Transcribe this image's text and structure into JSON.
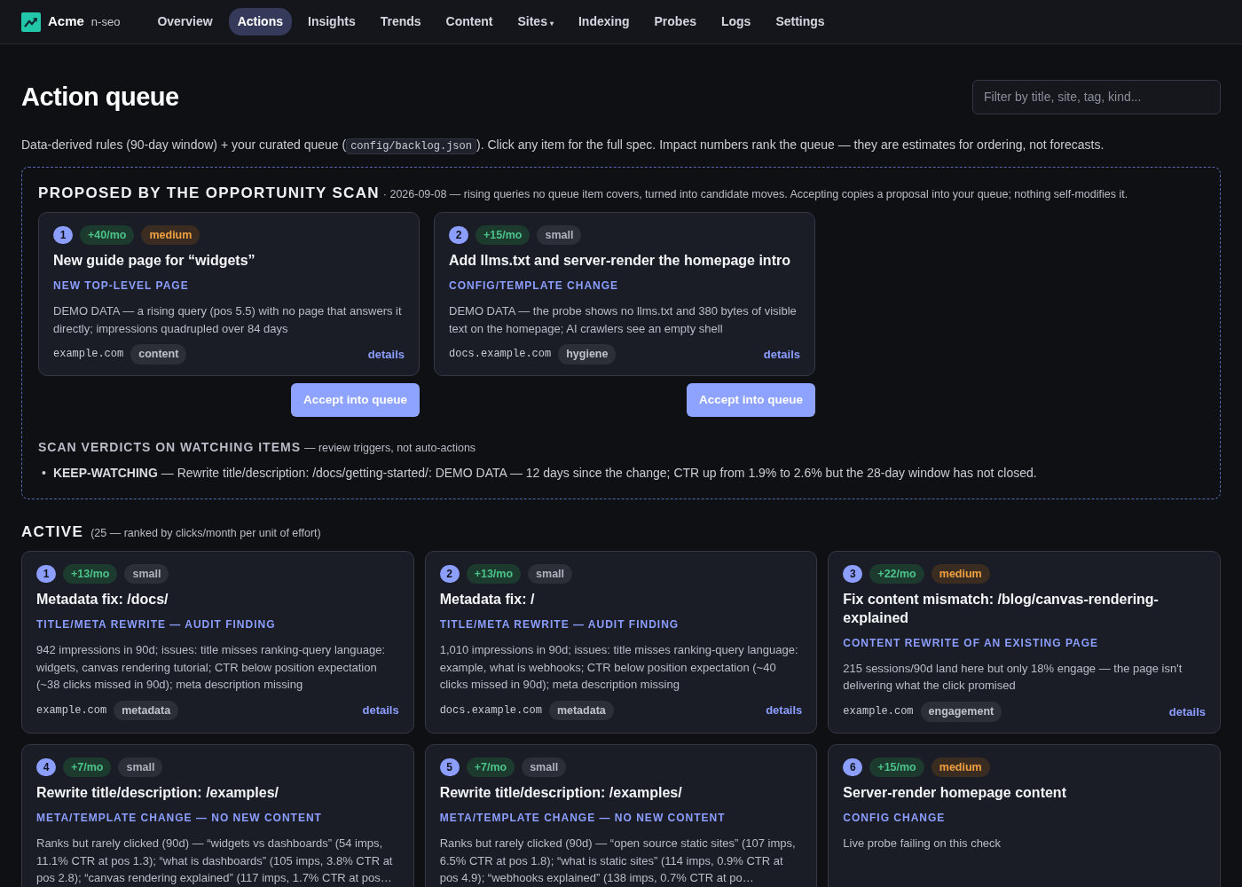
{
  "brand": {
    "name": "Acme",
    "suffix": "n-seo"
  },
  "nav": [
    {
      "label": "Overview",
      "selected": false
    },
    {
      "label": "Actions",
      "selected": true
    },
    {
      "label": "Insights",
      "selected": false
    },
    {
      "label": "Trends",
      "selected": false
    },
    {
      "label": "Content",
      "selected": false
    },
    {
      "label": "Sites",
      "selected": false,
      "caret": "▾"
    },
    {
      "label": "Indexing",
      "selected": false
    },
    {
      "label": "Probes",
      "selected": false
    },
    {
      "label": "Logs",
      "selected": false
    },
    {
      "label": "Settings",
      "selected": false
    }
  ],
  "page": {
    "title": "Action queue",
    "filter": {
      "placeholder": "Filter by title, site, tag, kind..."
    },
    "intro": {
      "before": "Data-derived rules (90-day window) + your curated queue (",
      "code": "config/backlog.json",
      "after": "). Click any item for the full spec. Impact numbers rank the queue — they are estimates for ordering, not forecasts."
    }
  },
  "proposals": {
    "heading": "PROPOSED BY THE OPPORTUNITY SCAN",
    "subtitle": "· 2026-09-08 — rising queries no queue item covers, turned into candidate moves. Accepting copies a proposal into your queue; nothing self-modifies it.",
    "cards": [
      {
        "rank": "1",
        "impact": "+40/mo",
        "effort": "medium",
        "title": "New guide page for “widgets”",
        "kind": "NEW TOP-LEVEL PAGE",
        "description": "DEMO DATA — a rising query (pos 5.5) with no page that answers it directly; impressions quadrupled over 84 days",
        "site": "example.com",
        "tag": "content",
        "link": "details",
        "button": "Accept into queue"
      },
      {
        "rank": "2",
        "impact": "+15/mo",
        "effort": "small",
        "title": "Add llms.txt and server-render the homepage intro",
        "kind": "CONFIG/TEMPLATE CHANGE",
        "description": "DEMO DATA — the probe shows no llms.txt and 380 bytes of visible text on the homepage; AI crawlers see an empty shell",
        "site": "docs.example.com",
        "tag": "hygiene",
        "link": "details",
        "button": "Accept into queue"
      }
    ],
    "verdicts": {
      "heading": "SCAN VERDICTS ON WATCHING ITEMS",
      "subtitle": "— review triggers, not auto-actions",
      "items": [
        {
          "bullet": "•",
          "verdict": "KEEP-WATCHING",
          "text": "— Rewrite title/description: /docs/getting-started/: DEMO DATA — 12 days since the change; CTR up from 1.9% to 2.6% but the 28-day window has not closed."
        }
      ]
    }
  },
  "active": {
    "heading": "ACTIVE",
    "subtitle": "(25 — ranked by clicks/month per unit of effort)",
    "cards": [
      {
        "rank": "1",
        "impact": "+13/mo",
        "effort": "small",
        "title": "Metadata fix: /docs/",
        "kind": "TITLE/META REWRITE — AUDIT FINDING",
        "description": "942 impressions in 90d; issues: title misses ranking-query language: widgets, canvas rendering tutorial; CTR below position expectation (~38 clicks missed in 90d); meta description missing",
        "site": "example.com",
        "tag": "metadata",
        "link": "details"
      },
      {
        "rank": "2",
        "impact": "+13/mo",
        "effort": "small",
        "title": "Metadata fix: /",
        "kind": "TITLE/META REWRITE — AUDIT FINDING",
        "description": "1,010 impressions in 90d; issues: title misses ranking-query language: example, what is webhooks; CTR below position expectation (~40 clicks missed in 90d); meta description missing",
        "site": "docs.example.com",
        "tag": "metadata",
        "link": "details"
      },
      {
        "rank": "3",
        "impact": "+22/mo",
        "effort": "medium",
        "title": "Fix content mismatch: /blog/canvas-rendering-explained",
        "kind": "CONTENT REWRITE OF AN EXISTING PAGE",
        "description": "215 sessions/90d land here but only 18% engage — the page isn't delivering what the click promised",
        "site": "example.com",
        "tag": "engagement",
        "link": "details"
      },
      {
        "rank": "4",
        "impact": "+7/mo",
        "effort": "small",
        "title": "Rewrite title/description: /examples/",
        "kind": "META/TEMPLATE CHANGE — NO NEW CONTENT",
        "description": "Ranks but rarely clicked (90d) — “widgets vs dashboards” (54 imps, 11.1% CTR at pos 1.3); “what is dashboards” (105 imps, 3.8% CTR at pos 2.8); “canvas rendering explained” (117 imps, 1.7% CTR at pos…"
      },
      {
        "rank": "5",
        "impact": "+7/mo",
        "effort": "small",
        "title": "Rewrite title/description: /examples/",
        "kind": "META/TEMPLATE CHANGE — NO NEW CONTENT",
        "description": "Ranks but rarely clicked (90d) — “open source static sites” (107 imps, 6.5% CTR at pos 1.8); “what is static sites” (114 imps, 0.9% CTR at pos 4.9); “webhooks explained” (138 imps, 0.7% CTR at po…"
      },
      {
        "rank": "6",
        "impact": "+15/mo",
        "effort": "medium",
        "title": "Server-render homepage content",
        "kind": "CONFIG CHANGE",
        "description": "Live probe failing on this check"
      }
    ]
  }
}
